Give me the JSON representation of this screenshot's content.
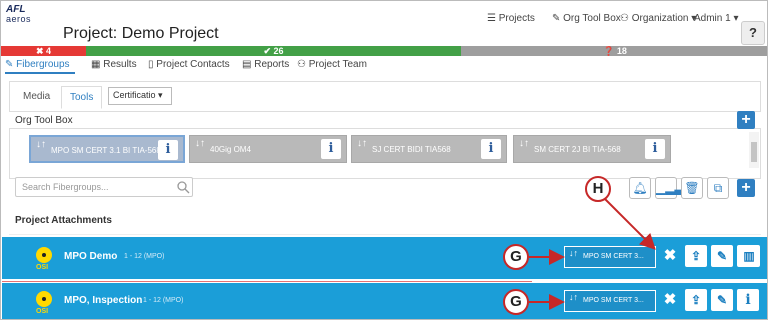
{
  "header": {
    "logo_line1": "AFL",
    "logo_line2": "aeros",
    "title": "Project: Demo Project",
    "nav": {
      "projects": "☰ Projects",
      "org_tool_box": "✎ Org Tool Box",
      "organization": "⚇ Organization ▾",
      "admin": "Admin 1 ▾"
    },
    "help": "?"
  },
  "status": {
    "fail": "✖ 4",
    "pass": "✔ 26",
    "pending": "❓ 18",
    "colors": {
      "fail": "#e53935",
      "pass": "#43a047",
      "pending": "#9e9e9e"
    }
  },
  "project_tabs": [
    "Fibergroups",
    "Results",
    "Project Contacts",
    "Reports",
    "Project Team"
  ],
  "sub_tabs": {
    "media": "Media",
    "tools": "Tools"
  },
  "cert_select": "Certificatio ▾",
  "org_tool_box_label": "Org Tool Box",
  "tools": [
    {
      "name": "MPO SM CERT 3.1 BI TIA-568"
    },
    {
      "name": "40Gig OM4"
    },
    {
      "name": "SJ CERT BIDI TIA568"
    },
    {
      "name": "SM CERT 2J BI TIA-568"
    }
  ],
  "search_placeholder": "Search Fibergroups...",
  "attachments_label": "Project Attachments",
  "rows": [
    {
      "name": "MPO Demo",
      "range": "1 - 12 (MPO)",
      "otdr": "OSI",
      "tool": "MPO SM CERT 3..."
    },
    {
      "name": "MPO, Inspection",
      "range": "1 - 12 (MPO)",
      "otdr": "OSI",
      "tool": "MPO SM CERT 3..."
    }
  ],
  "callouts": {
    "h": "H",
    "g1": "G",
    "g2": "G"
  },
  "accent": "#2f7fc1",
  "row_color": "#1b9ed8"
}
